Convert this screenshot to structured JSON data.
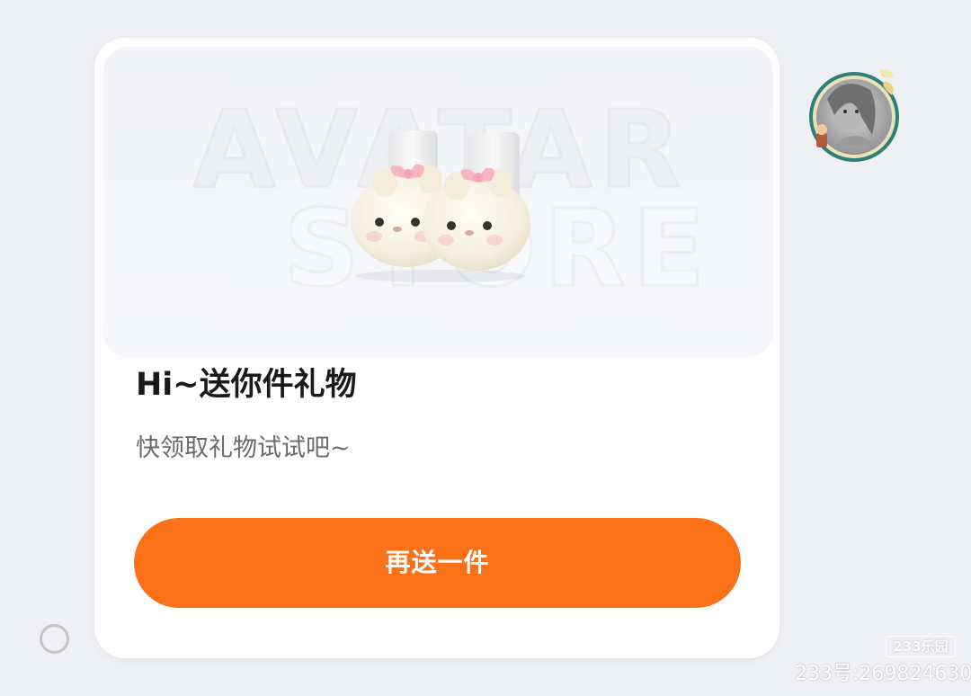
{
  "gift_card": {
    "banner": {
      "watermark_line1": "AVATAR",
      "watermark_line2": "STORE",
      "product_image": "bunny-slippers-image"
    },
    "title": "Hi~送你件礼物",
    "subtitle": "快领取礼物试试吧~",
    "button_label": "再送一件"
  },
  "sender": {
    "avatar": "user-avatar-image"
  },
  "watermark": {
    "brand": "233乐园",
    "user_id": "233号:269824630"
  },
  "colors": {
    "accent": "#fb7117",
    "background": "#eef0f4",
    "card": "#ffffff",
    "title_text": "#1a1a1a",
    "subtitle_text": "#6b6b6b"
  }
}
